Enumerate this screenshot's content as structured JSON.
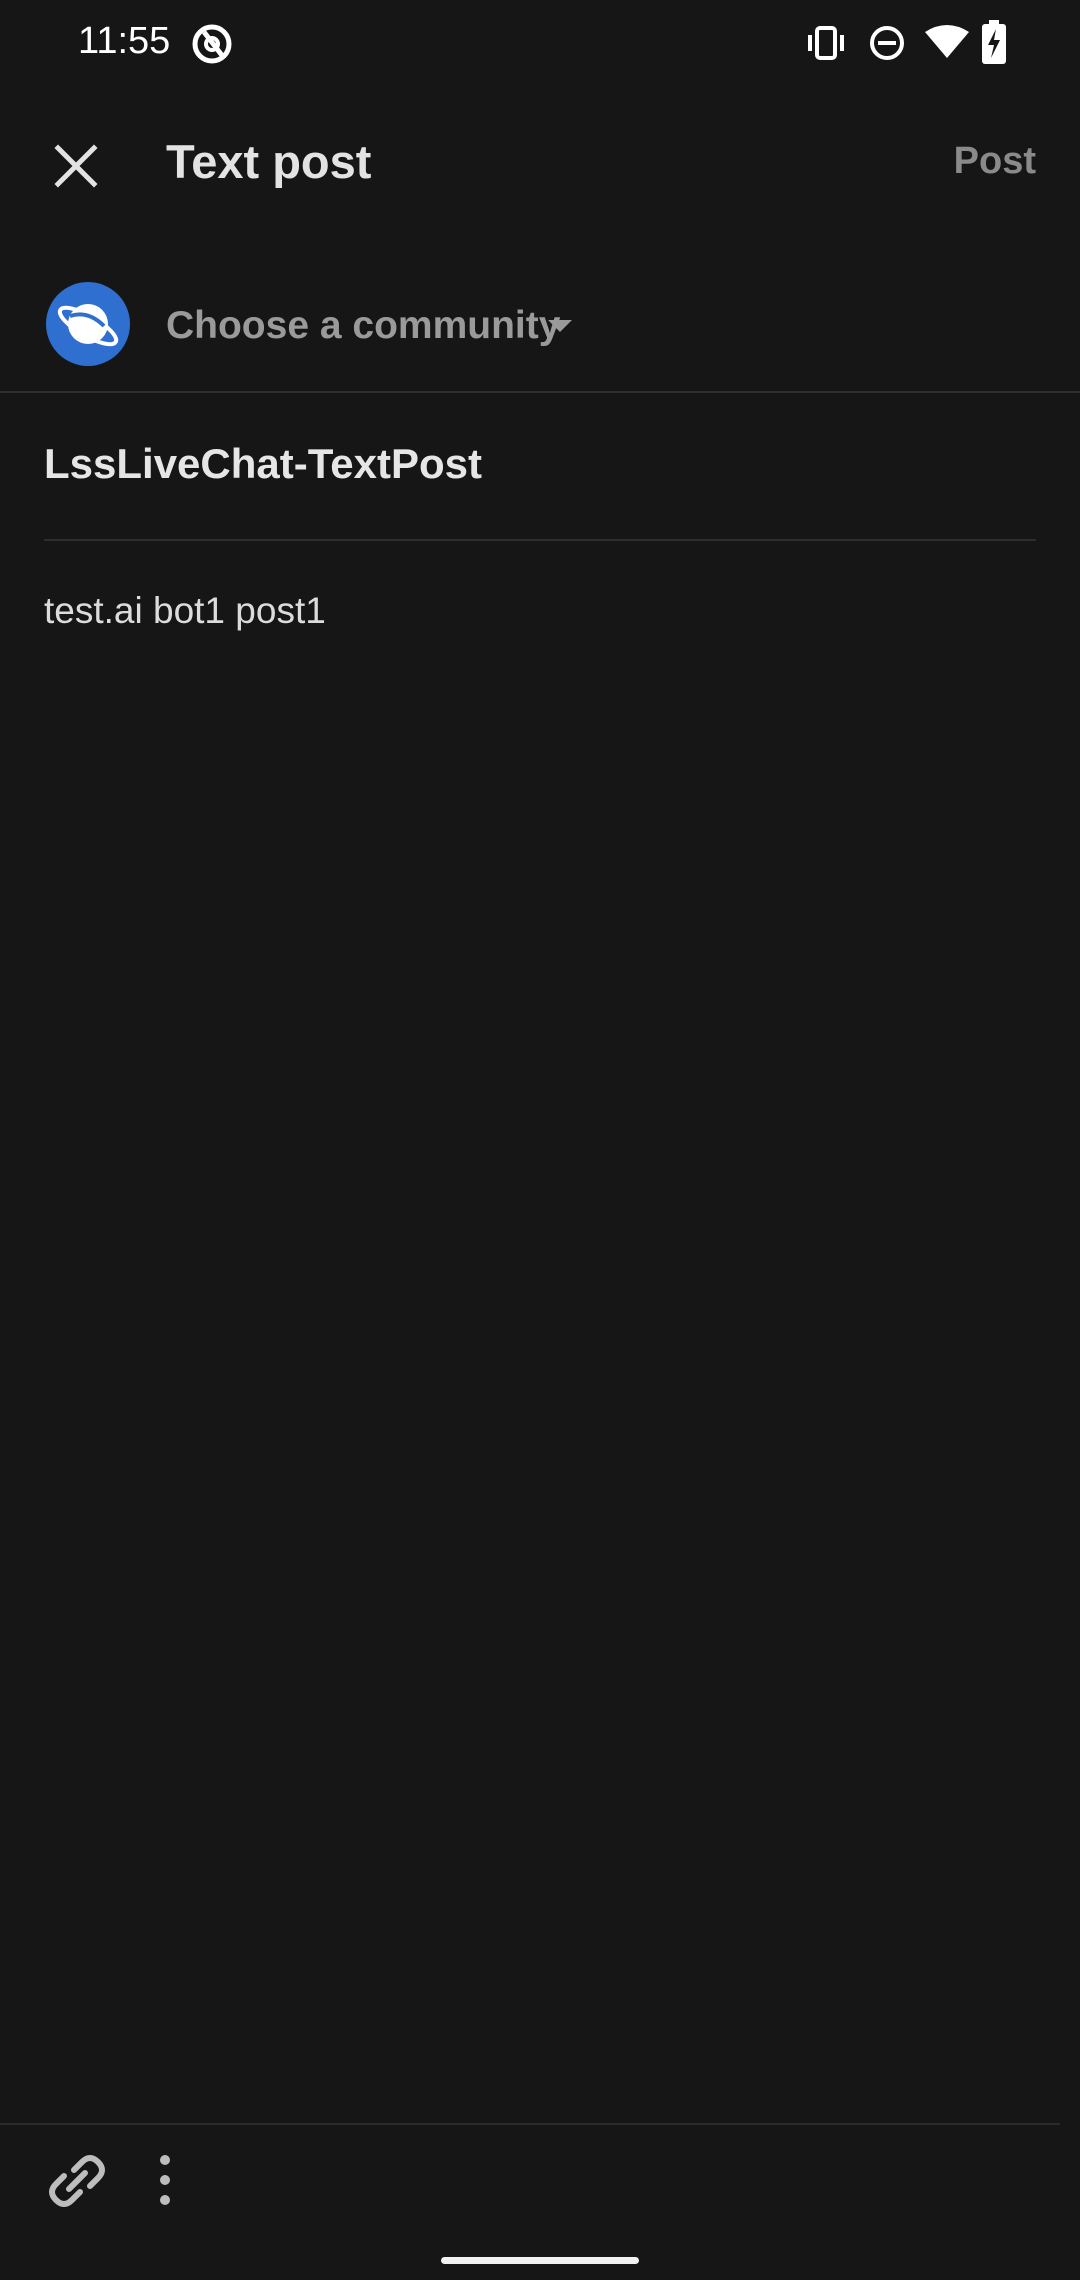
{
  "status_bar": {
    "time": "11:55",
    "icons": [
      "app-notification-icon",
      "vibrate-icon",
      "do-not-disturb-icon",
      "wifi-icon",
      "battery-charging-icon"
    ]
  },
  "toolbar": {
    "close_icon": "close-icon",
    "title": "Text post",
    "post_label": "Post"
  },
  "community": {
    "avatar_icon": "planet-icon",
    "label": "Choose a community",
    "caret_icon": "caret-down-icon",
    "avatar_color": "#2f6fd0"
  },
  "post": {
    "title": "LssLiveChat-TextPost",
    "body": "test.ai bot1 post1"
  },
  "bottom_bar": {
    "icons": [
      "link-icon",
      "more-vertical-icon"
    ]
  },
  "colors": {
    "background": "#161616",
    "text_primary": "#e6e6e6",
    "text_muted": "#9a9a9a",
    "divider": "#2e2e2e"
  }
}
